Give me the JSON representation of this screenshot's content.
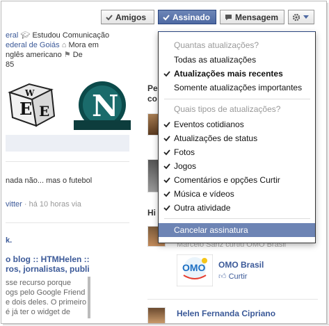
{
  "buttons": {
    "amigos": "Amigos",
    "assinado": "Assinado",
    "mensagem": "Mensagem"
  },
  "profile_info": {
    "line1_a": "eral",
    "line1_b": "Estudou Comunicação",
    "line2_a": "ederal de Goiás",
    "line2_b": "Mora em",
    "line3_a": "nglês americano",
    "line3_b": "De",
    "line4": "85"
  },
  "post": {
    "text": "nada não... mas o futebol",
    "via": "vitter",
    "time": "há 10 horas via"
  },
  "blog": {
    "label": "k.",
    "title_line1": "o blog :: HTMHelen ::",
    "title_line2": "ros, jornalistas, publi",
    "desc_line1": "sse recurso porque",
    "desc_line2": "ogs pelo Google Friend",
    "desc_line3": "e dois deles. O primeiro",
    "desc_line4": "é já ter o widget de"
  },
  "right_col": {
    "heading1_a": "Pe",
    "heading1_b": "co",
    "heading2": "Hi",
    "partial_text": "Marcelo Sanz curtiu OMO Brasil",
    "page_name": "OMO Brasil",
    "like_label": "Curtir",
    "person_name": "Helen Fernanda Cipriano"
  },
  "dropdown": {
    "section1_header": "Quantas atualizações?",
    "section1_items": [
      {
        "label": "Todas as atualizações",
        "checked": false,
        "bold": false
      },
      {
        "label": "Atualizações mais recentes",
        "checked": true,
        "bold": true
      },
      {
        "label": "Somente atualizações importantes",
        "checked": false,
        "bold": false
      }
    ],
    "section2_header": "Quais tipos de atualizações?",
    "section2_items": [
      {
        "label": "Eventos cotidianos",
        "checked": true
      },
      {
        "label": "Atualizações de status",
        "checked": true
      },
      {
        "label": "Fotos",
        "checked": true
      },
      {
        "label": "Jogos",
        "checked": true
      },
      {
        "label": "Comentários e opções Curtir",
        "checked": true
      },
      {
        "label": "Música e vídeos",
        "checked": true
      },
      {
        "label": "Outra atividade",
        "checked": true
      }
    ],
    "cancel_label": "Cancelar assinatura"
  },
  "colors": {
    "link": "#3b5998",
    "highlight": "#6d84b4",
    "button_blue": "#5b74a8"
  }
}
